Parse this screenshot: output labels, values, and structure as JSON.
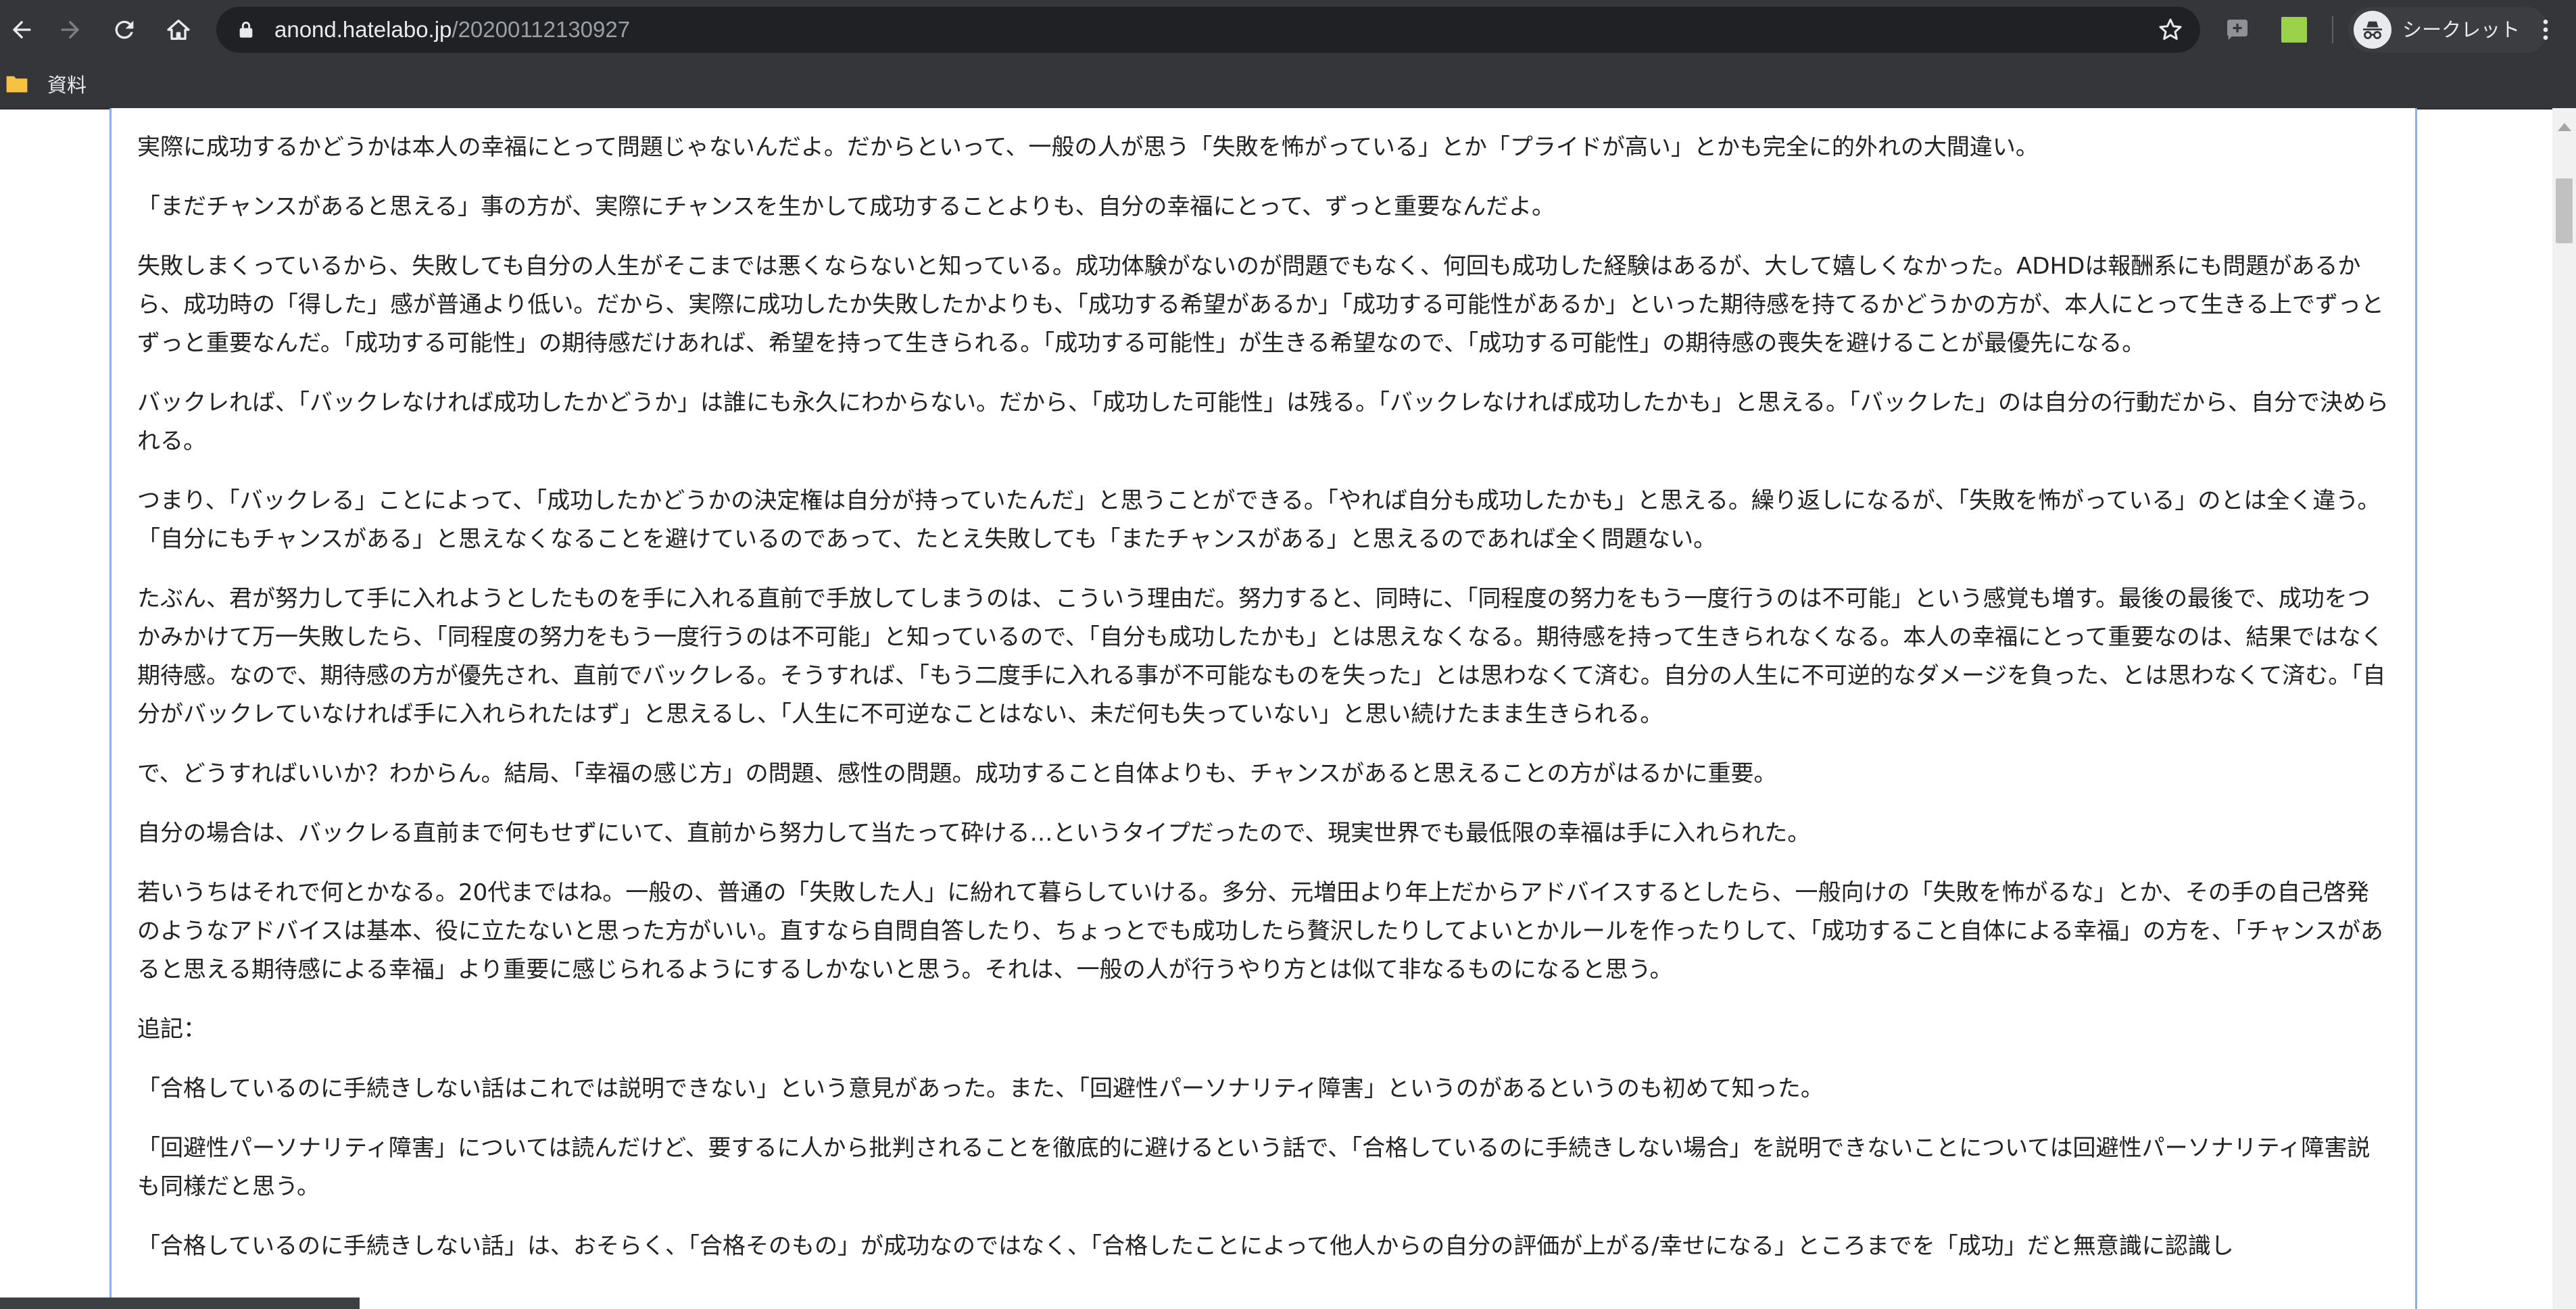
{
  "browser": {
    "url_host": "anond.hatelabo.jp",
    "url_path": "/20200112130927",
    "profile_label": "シークレット"
  },
  "bookmarks": [
    {
      "label": "資料"
    }
  ],
  "article": {
    "paragraphs": [
      "実際に成功するかどうかは本人の幸福にとって問題じゃないんだよ。だからといって、一般の人が思う「失敗を怖がっている」とか「プライドが高い」とかも完全に的外れの大間違い。",
      "「まだチャンスがあると思える」事の方が、実際にチャンスを生かして成功することよりも、自分の幸福にとって、ずっと重要なんだよ。",
      "失敗しまくっているから、失敗しても自分の人生がそこまでは悪くならないと知っている。成功体験がないのが問題でもなく、何回も成功した経験はあるが、大して嬉しくなかった。ADHDは報酬系にも問題があるから、成功時の「得した」感が普通より低い。だから、実際に成功したか失敗したかよりも、「成功する希望があるか」「成功する可能性があるか」といった期待感を持てるかどうかの方が、本人にとって生きる上でずっとずっと重要なんだ。「成功する可能性」の期待感だけあれば、希望を持って生きられる。「成功する可能性」が生きる希望なので、「成功する可能性」の期待感の喪失を避けることが最優先になる。",
      "バックレれば、「バックレなければ成功したかどうか」は誰にも永久にわからない。だから、「成功した可能性」は残る。「バックレなければ成功したかも」と思える。「バックレた」のは自分の行動だから、自分で決められる。",
      "つまり、「バックレる」ことによって、「成功したかどうかの決定権は自分が持っていたんだ」と思うことができる。「やれば自分も成功したかも」と思える。繰り返しになるが、「失敗を怖がっている」のとは全く違う。「自分にもチャンスがある」と思えなくなることを避けているのであって、たとえ失敗しても「またチャンスがある」と思えるのであれば全く問題ない。",
      "たぶん、君が努力して手に入れようとしたものを手に入れる直前で手放してしまうのは、こういう理由だ。努力すると、同時に、「同程度の努力をもう一度行うのは不可能」という感覚も増す。最後の最後で、成功をつかみかけて万一失敗したら、「同程度の努力をもう一度行うのは不可能」と知っているので、「自分も成功したかも」とは思えなくなる。期待感を持って生きられなくなる。本人の幸福にとって重要なのは、結果ではなく期待感。なので、期待感の方が優先され、直前でバックレる。そうすれば、「もう二度手に入れる事が不可能なものを失った」とは思わなくて済む。自分の人生に不可逆的なダメージを負った、とは思わなくて済む。「自分がバックレていなければ手に入れられたはず」と思えるし、「人生に不可逆なことはない、未だ何も失っていない」と思い続けたまま生きられる。",
      "で、どうすればいいか？わからん。結局、「幸福の感じ方」の問題、感性の問題。成功すること自体よりも、チャンスがあると思えることの方がはるかに重要。",
      "自分の場合は、バックレる直前まで何もせずにいて、直前から努力して当たって砕ける…というタイプだったので、現実世界でも最低限の幸福は手に入れられた。",
      "若いうちはそれで何とかなる。20代まではね。一般の、普通の「失敗した人」に紛れて暮らしていける。多分、元増田より年上だからアドバイスするとしたら、一般向けの「失敗を怖がるな」とか、その手の自己啓発のようなアドバイスは基本、役に立たないと思った方がいい。直すなら自問自答したり、ちょっとでも成功したら贅沢したりしてよいとかルールを作ったりして、「成功すること自体による幸福」の方を、「チャンスがあると思える期待感による幸福」より重要に感じられるようにするしかないと思う。それは、一般の人が行うやり方とは似て非なるものになると思う。",
      "追記：",
      "「合格しているのに手続きしない話はこれでは説明できない」という意見があった。また、「回避性パーソナリティ障害」というのがあるというのも初めて知った。",
      "「回避性パーソナリティ障害」については読んだけど、要するに人から批判されることを徹底的に避けるという話で、「合格しているのに手続きしない場合」を説明できないことについては回避性パーソナリティ障害説も同様だと思う。",
      "「合格しているのに手続きしない話」は、おそらく、「合格そのもの」が成功なのではなく、「合格したことによって他人からの自分の評価が上がる/幸せになる」ところまでを「成功」だと無意識に認識し"
    ]
  }
}
